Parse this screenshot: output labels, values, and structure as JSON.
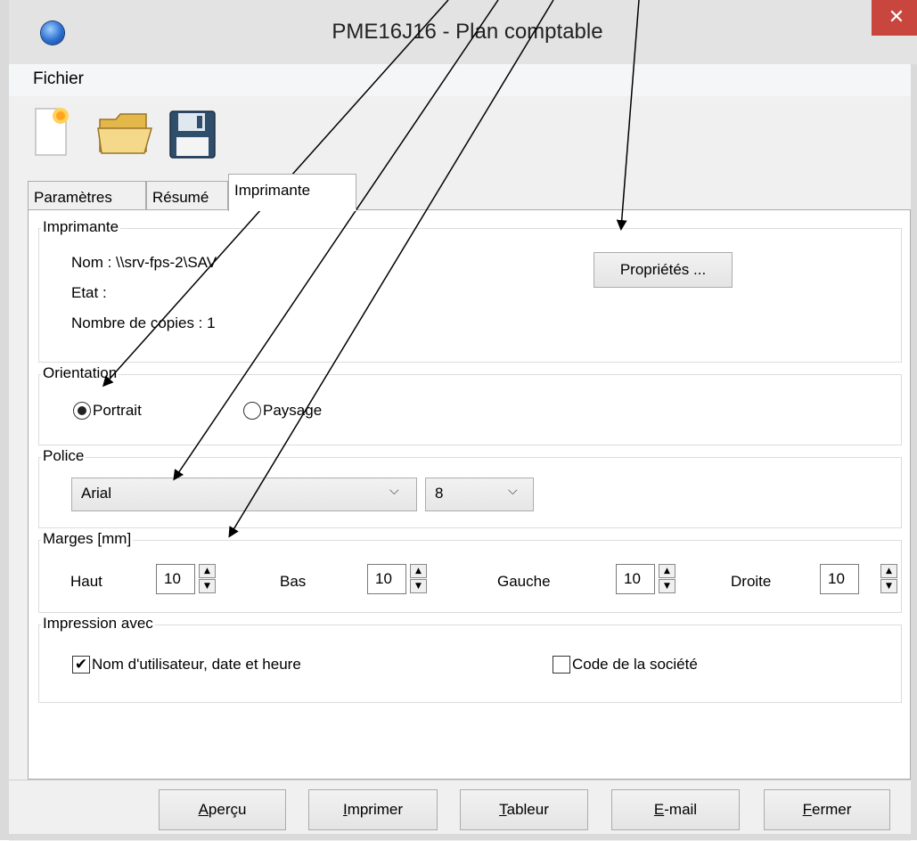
{
  "window": {
    "title": "PME16J16 - Plan comptable",
    "close_symbol": "✕"
  },
  "menu": {
    "file_label": "Fichier"
  },
  "toolbar": {
    "icons": [
      "new-document-icon",
      "open-folder-icon",
      "save-disk-icon"
    ]
  },
  "tabs": [
    {
      "label": "Paramètres",
      "active": false
    },
    {
      "label": "Résumé",
      "active": false
    },
    {
      "label": "Imprimante",
      "active": true
    }
  ],
  "printer_group": {
    "title": "Imprimante",
    "name_line": "Nom : \\\\srv-fps-2\\SAV",
    "state_line": "Etat :",
    "copies_line": "Nombre de copies : 1",
    "properties_button": "Propriétés ..."
  },
  "orientation_group": {
    "title": "Orientation",
    "options": [
      "Portrait",
      "Paysage"
    ],
    "selected": "Portrait"
  },
  "font_group": {
    "title": "Police",
    "font_value": "Arial",
    "size_value": "8"
  },
  "margins_group": {
    "title": "Marges [mm]",
    "fields": [
      {
        "label": "Haut",
        "value": "10"
      },
      {
        "label": "Bas",
        "value": "10"
      },
      {
        "label": "Gauche",
        "value": "10"
      },
      {
        "label": "Droite",
        "value": "10"
      }
    ]
  },
  "print_with_group": {
    "title": "Impression avec",
    "options": [
      {
        "label": "Nom d'utilisateur, date et heure",
        "checked": true
      },
      {
        "label": "Code de la société",
        "checked": false
      }
    ],
    "check_mark": "✔"
  },
  "buttons": {
    "preview": {
      "accel": "A",
      "rest": "perçu"
    },
    "print": {
      "accel": "I",
      "rest": "mprimer"
    },
    "spreadsheet": {
      "accel": "T",
      "rest": "ableur"
    },
    "email": {
      "accel": "E",
      "rest": "-mail"
    },
    "close": {
      "accel": "F",
      "rest": "ermer"
    }
  },
  "spin_up_symbol": "▲",
  "spin_down_symbol": "▼",
  "combo_arrow_symbol": "⌵"
}
